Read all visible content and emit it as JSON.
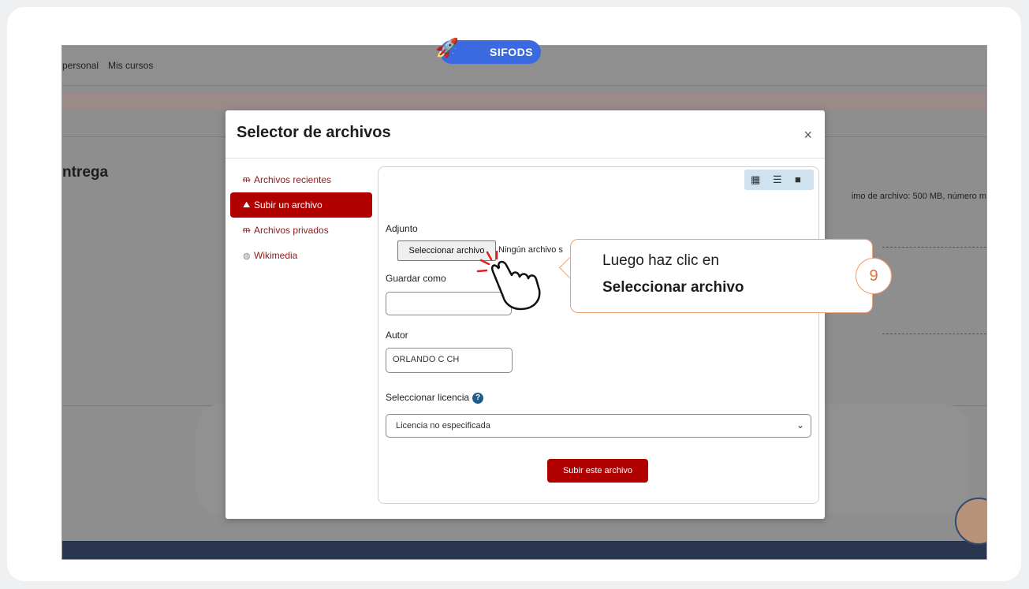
{
  "background": {
    "nav_personal": "personal",
    "nav_mis_cursos": "Mis cursos",
    "brand": "SIFODS",
    "heading_fragment": "ntrega",
    "file_limit_fragment": "imo de archivo: 500 MB, número m"
  },
  "modal": {
    "title": "Selector de archivos",
    "close_glyph": "×",
    "sidebar": [
      {
        "label": "Archivos recientes",
        "icon": "moodle-icon",
        "active": false
      },
      {
        "label": "Subir un archivo",
        "icon": "upload-icon",
        "active": true
      },
      {
        "label": "Archivos privados",
        "icon": "moodle-icon",
        "active": false
      },
      {
        "label": "Wikimedia",
        "icon": "wikimedia-icon",
        "active": false
      }
    ],
    "view_buttons": [
      "grid-view-icon",
      "list-view-icon",
      "folder-view-icon"
    ],
    "form": {
      "adjunto_label": "Adjunto",
      "choose_file_button": "Seleccionar archivo",
      "no_file_text": "Ningún archivo s",
      "save_as_label": "Guardar como",
      "save_as_value": "",
      "author_label": "Autor",
      "author_value": "ORLANDO C CH",
      "license_label": "Seleccionar licencia",
      "license_help_glyph": "?",
      "license_value": "Licencia no especificada",
      "submit_button": "Subir este archivo"
    }
  },
  "callout": {
    "line1": "Luego haz clic en",
    "line2": "Seleccionar archivo",
    "step_number": "9"
  },
  "colors": {
    "accent_red": "#b10000",
    "callout_border": "#f0a076",
    "brand_blue": "#3b6ae0"
  }
}
